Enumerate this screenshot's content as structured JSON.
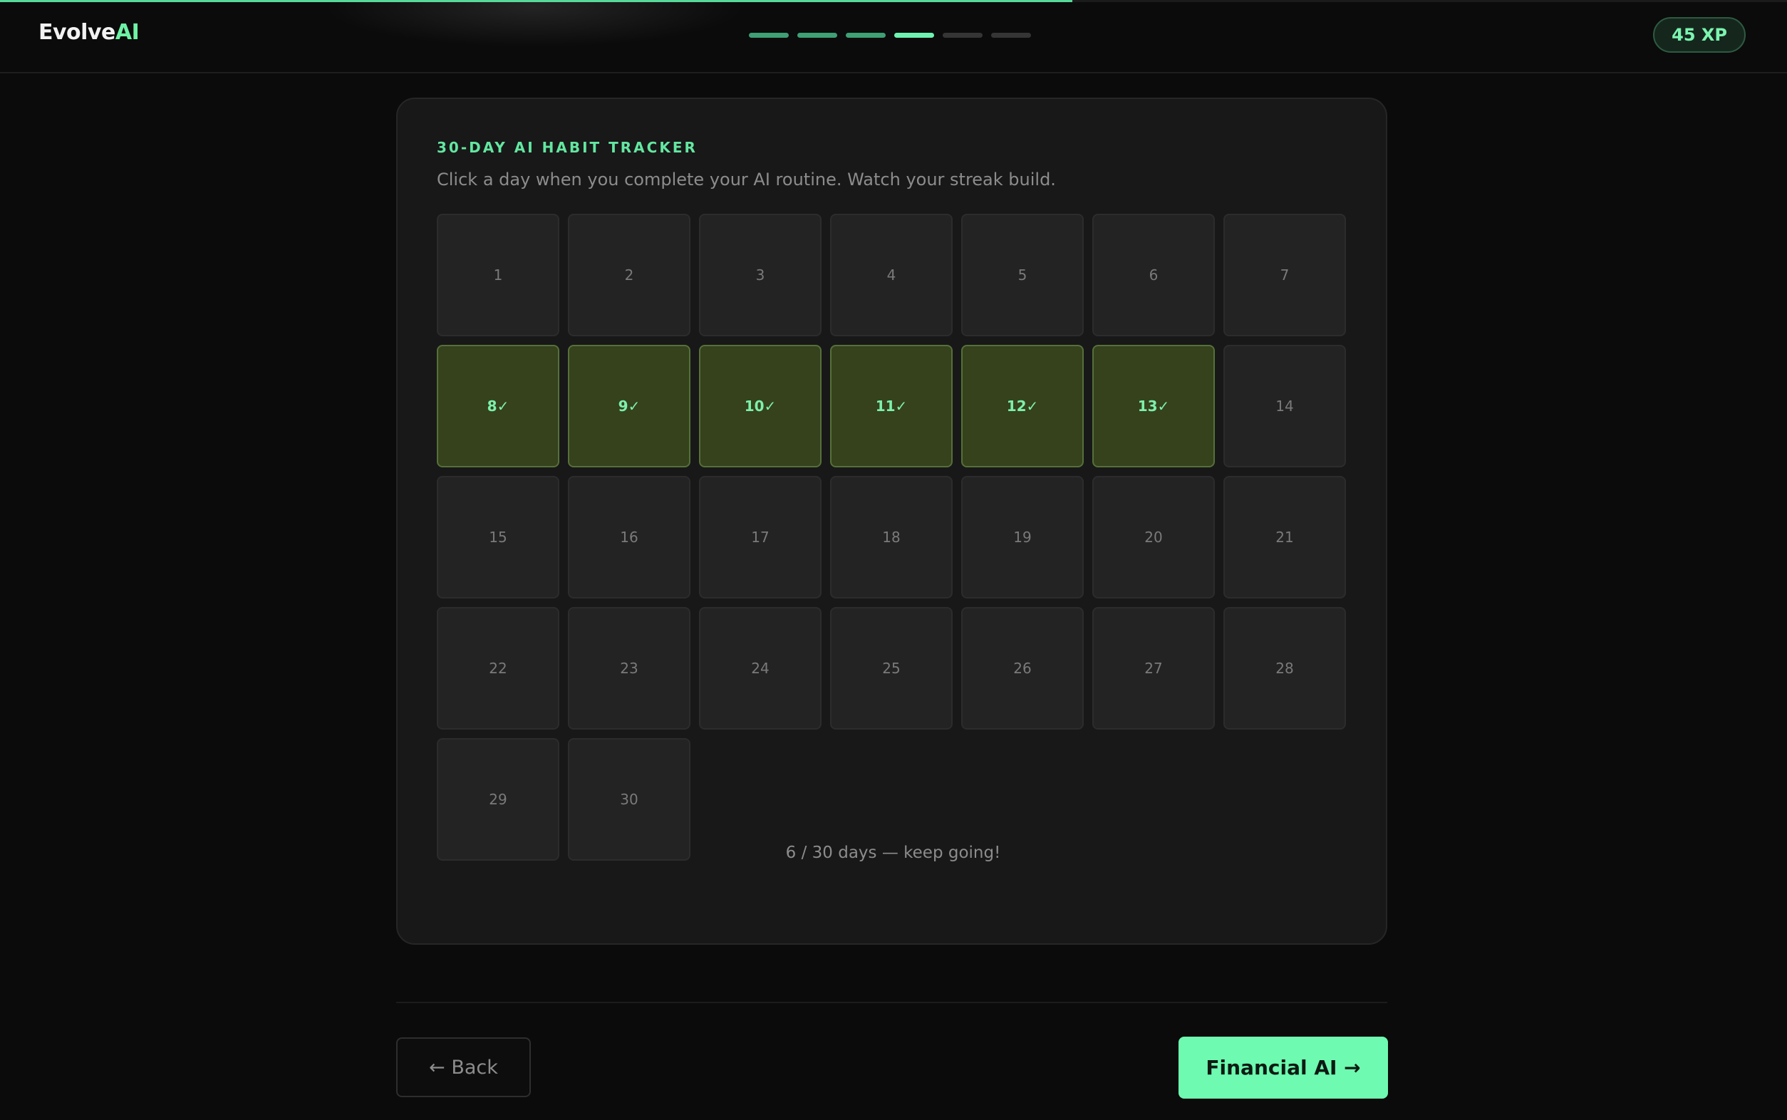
{
  "header": {
    "brand_main": "Evolve",
    "brand_accent": "AI",
    "xp": "45 XP",
    "steps": [
      {
        "state": "done"
      },
      {
        "state": "done"
      },
      {
        "state": "done"
      },
      {
        "state": "current"
      },
      {
        "state": "todo"
      },
      {
        "state": "todo"
      }
    ],
    "overall_progress": 0.6
  },
  "tracker": {
    "title": "30-DAY AI HABIT TRACKER",
    "subtitle": "Click a day when you complete your AI routine. Watch your streak build.",
    "days": [
      {
        "label": "1",
        "done": false
      },
      {
        "label": "2",
        "done": false
      },
      {
        "label": "3",
        "done": false
      },
      {
        "label": "4",
        "done": false
      },
      {
        "label": "5",
        "done": false
      },
      {
        "label": "6",
        "done": false
      },
      {
        "label": "7",
        "done": false
      },
      {
        "label": "8✓",
        "done": true
      },
      {
        "label": "9✓",
        "done": true
      },
      {
        "label": "10✓",
        "done": true
      },
      {
        "label": "11✓",
        "done": true
      },
      {
        "label": "12✓",
        "done": true
      },
      {
        "label": "13✓",
        "done": true
      },
      {
        "label": "14",
        "done": false
      },
      {
        "label": "15",
        "done": false
      },
      {
        "label": "16",
        "done": false
      },
      {
        "label": "17",
        "done": false
      },
      {
        "label": "18",
        "done": false
      },
      {
        "label": "19",
        "done": false
      },
      {
        "label": "20",
        "done": false
      },
      {
        "label": "21",
        "done": false
      },
      {
        "label": "22",
        "done": false
      },
      {
        "label": "23",
        "done": false
      },
      {
        "label": "24",
        "done": false
      },
      {
        "label": "25",
        "done": false
      },
      {
        "label": "26",
        "done": false
      },
      {
        "label": "27",
        "done": false
      },
      {
        "label": "28",
        "done": false
      },
      {
        "label": "29",
        "done": false
      },
      {
        "label": "30",
        "done": false
      }
    ],
    "progress_text": "6 / 30 days — keep going!"
  },
  "footer": {
    "back_label": "← Back",
    "next_label": "Financial AI →"
  },
  "colors": {
    "accent": "#6ef2a6",
    "done_cell": "#35421c",
    "background": "#0b0b0b"
  }
}
